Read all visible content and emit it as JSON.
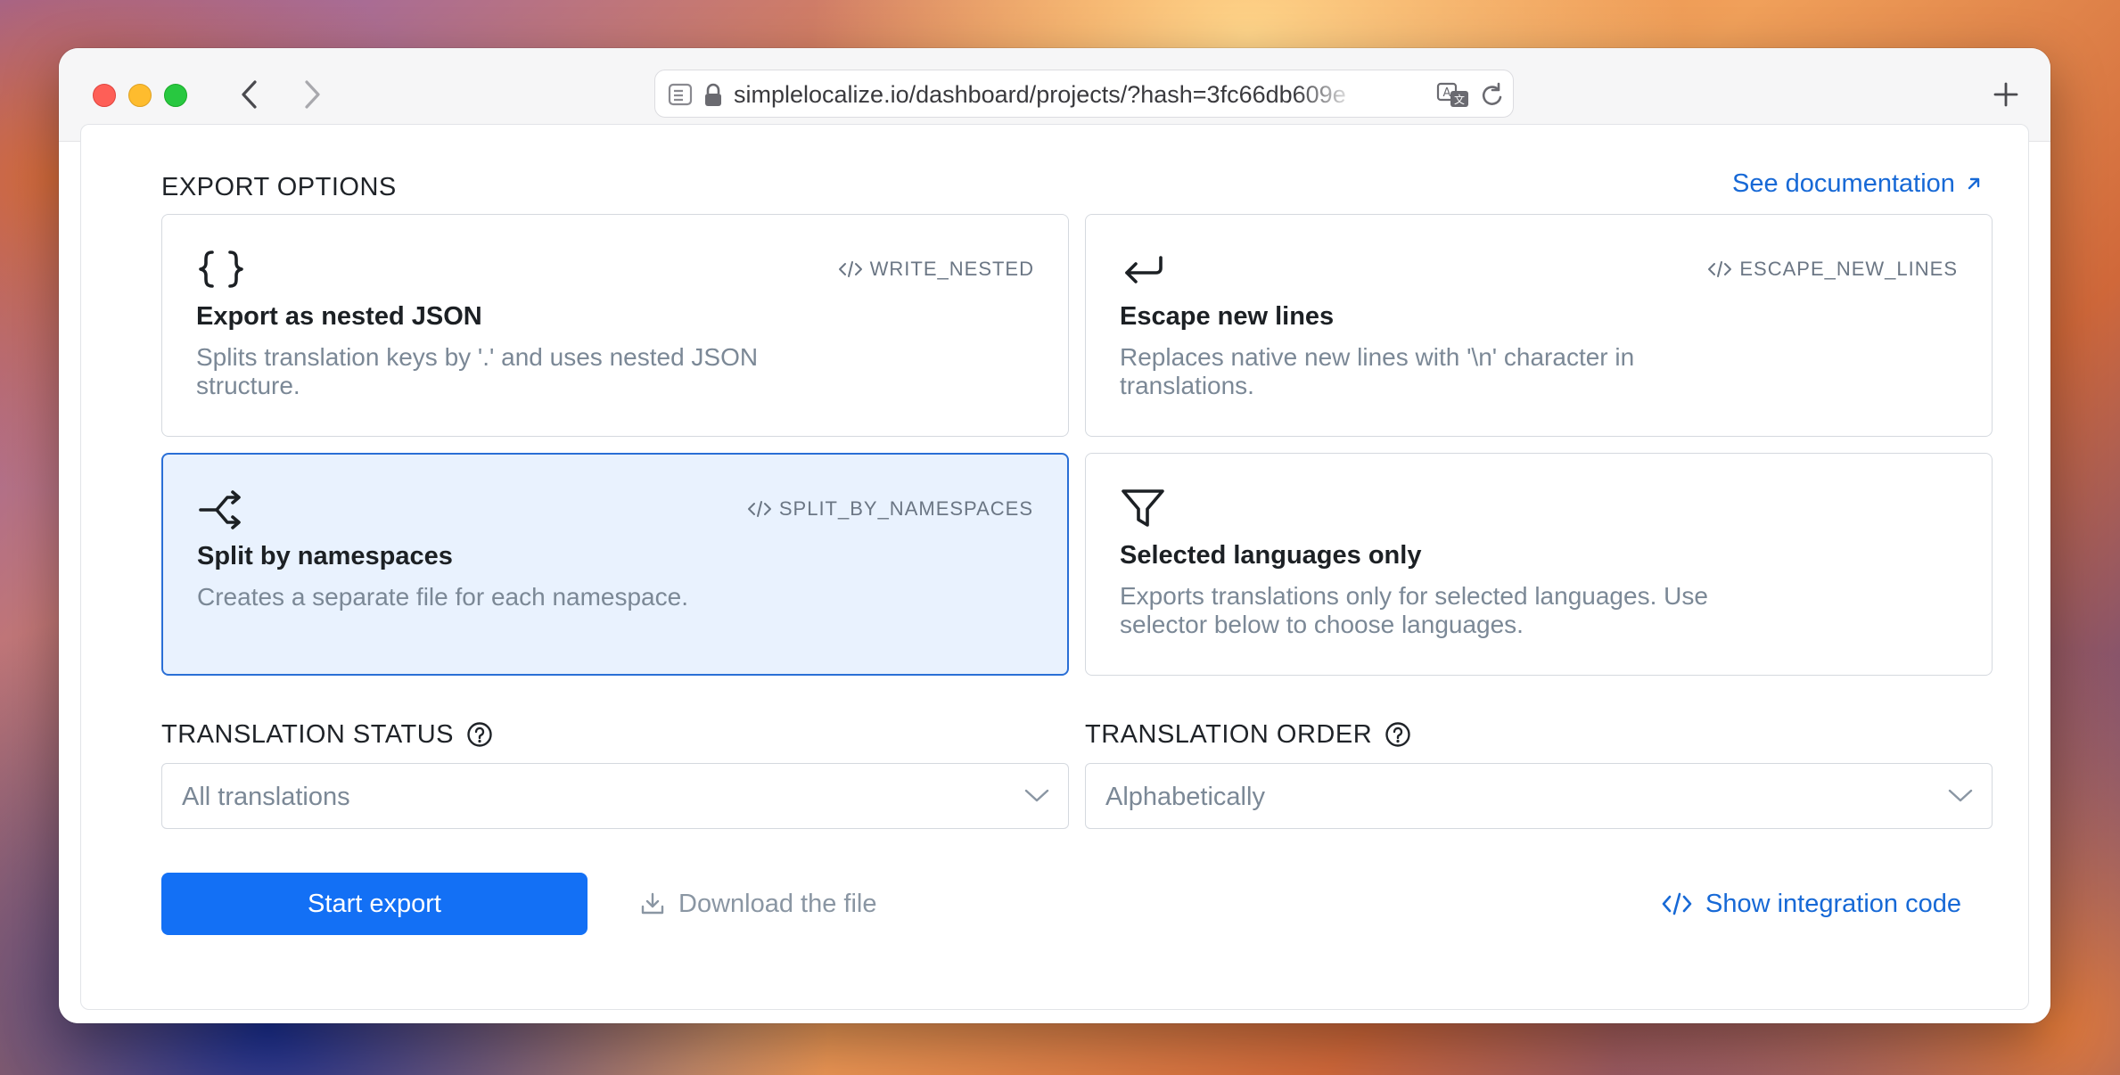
{
  "browser": {
    "url": "simplelocalize.io/dashboard/projects/?hash=3fc66db609e"
  },
  "export_options": {
    "title": "EXPORT OPTIONS",
    "docs_link": "See documentation",
    "cards": [
      {
        "icon": "curly-braces-icon",
        "code": "WRITE_NESTED",
        "title": "Export as nested JSON",
        "description": "Splits translation keys by '.' and uses nested JSON structure.",
        "selected": false
      },
      {
        "icon": "return-arrow-icon",
        "code": "ESCAPE_NEW_LINES",
        "title": "Escape new lines",
        "description": "Replaces native new lines with '\\n' character in translations.",
        "selected": false
      },
      {
        "icon": "split-arrows-icon",
        "code": "SPLIT_BY_NAMESPACES",
        "title": "Split by namespaces",
        "description": "Creates a separate file for each namespace.",
        "selected": true
      },
      {
        "icon": "funnel-filter-icon",
        "code": "",
        "title": "Selected languages only",
        "description": "Exports translations only for selected languages. Use selector below to choose languages.",
        "selected": false
      }
    ]
  },
  "translation_status": {
    "label": "TRANSLATION STATUS",
    "value": "All translations"
  },
  "translation_order": {
    "label": "TRANSLATION ORDER",
    "value": "Alphabetically"
  },
  "actions": {
    "start_export": "Start export",
    "download_file": "Download the file",
    "show_integration_code": "Show integration code"
  },
  "colors": {
    "accent": "#1370f5",
    "link": "#1769d6",
    "selected_bg": "#e9f2fe",
    "selected_border": "#2a6fd6"
  }
}
